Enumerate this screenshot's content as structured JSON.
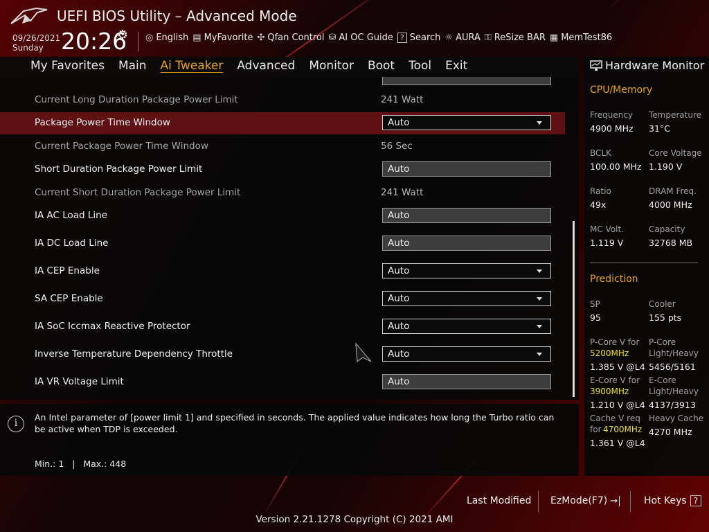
{
  "header": {
    "title": "UEFI BIOS Utility – Advanced Mode",
    "date": "09/26/2021",
    "day": "Sunday",
    "time": "20:26",
    "toolbar": [
      {
        "icon": "globe-icon",
        "label": "English"
      },
      {
        "icon": "favorite-icon",
        "label": "MyFavorite"
      },
      {
        "icon": "fan-icon",
        "label": "Qfan Control"
      },
      {
        "icon": "ai-oc-guide-icon",
        "label": "AI OC Guide"
      },
      {
        "icon": "search-help-icon",
        "label": "Search"
      },
      {
        "icon": "aura-icon",
        "label": "AURA"
      },
      {
        "icon": "resize-bar-icon",
        "label": "ReSize BAR"
      },
      {
        "icon": "memtest-icon",
        "label": "MemTest86"
      }
    ]
  },
  "tabs": [
    {
      "label": "My Favorites",
      "active": false
    },
    {
      "label": "Main",
      "active": false
    },
    {
      "label": "Ai Tweaker",
      "active": true
    },
    {
      "label": "Advanced",
      "active": false
    },
    {
      "label": "Monitor",
      "active": false
    },
    {
      "label": "Boot",
      "active": false
    },
    {
      "label": "Tool",
      "active": false
    },
    {
      "label": "Exit",
      "active": false
    }
  ],
  "settings": [
    {
      "label": "Current Long Duration Package Power Limit",
      "value": "241 Watt",
      "kind": "info"
    },
    {
      "label": "Package Power Time Window",
      "value": "Auto",
      "kind": "dropdown",
      "selected": true
    },
    {
      "label": "Current Package Power Time Window",
      "value": "56 Sec",
      "kind": "info"
    },
    {
      "label": "Short Duration Package Power Limit",
      "value": "Auto",
      "kind": "input"
    },
    {
      "label": "Current Short Duration Package Power Limit",
      "value": "241 Watt",
      "kind": "info"
    },
    {
      "label": "IA AC Load Line",
      "value": "Auto",
      "kind": "input"
    },
    {
      "label": "IA DC Load Line",
      "value": "Auto",
      "kind": "input"
    },
    {
      "label": "IA CEP Enable",
      "value": "Auto",
      "kind": "dropdown"
    },
    {
      "label": "SA CEP Enable",
      "value": "Auto",
      "kind": "dropdown"
    },
    {
      "label": "IA SoC Iccmax Reactive Protector",
      "value": "Auto",
      "kind": "dropdown"
    },
    {
      "label": "Inverse Temperature Dependency Throttle",
      "value": "Auto",
      "kind": "dropdown"
    },
    {
      "label": "IA VR Voltage Limit",
      "value": "Auto",
      "kind": "input"
    }
  ],
  "help": {
    "text": "An Intel parameter of [power limit 1] and specified in seconds. The applied value indicates how long the Turbo ratio can be active when TDP is exceeded.",
    "minmax": "Min.: 1   |   Max.: 448"
  },
  "hw_monitor": {
    "title": "Hardware Monitor",
    "cpu_section": "CPU/Memory",
    "cpu": [
      {
        "label": "Frequency",
        "value": "4900 MHz"
      },
      {
        "label": "Temperature",
        "value": "31°C"
      },
      {
        "label": "BCLK",
        "value": "100.00 MHz"
      },
      {
        "label": "Core Voltage",
        "value": "1.190 V"
      },
      {
        "label": "Ratio",
        "value": "49x"
      },
      {
        "label": "DRAM Freq.",
        "value": "4000 MHz"
      },
      {
        "label": "MC Volt.",
        "value": "1.119 V"
      },
      {
        "label": "Capacity",
        "value": "32768 MB"
      }
    ],
    "prediction_section": "Prediction",
    "sp_label": "SP",
    "sp_value": "95",
    "cooler_label": "Cooler",
    "cooler_value": "155 pts",
    "pcore_v_label": "P-Core V for",
    "pcore_v_freq": "5200MHz",
    "pcore_v_value": "1.385 V @L4",
    "pcore_lh_label1": "P-Core",
    "pcore_lh_label2": "Light/Heavy",
    "pcore_lh_value": "5456/5161",
    "ecore_v_label": "E-Core V for",
    "ecore_v_freq": "3900MHz",
    "ecore_v_value": "1.210 V @L4",
    "ecore_lh_label1": "E-Core",
    "ecore_lh_label2": "Light/Heavy",
    "ecore_lh_value": "4137/3913",
    "cache_v_label": "Cache V req",
    "cache_v_for": "for",
    "cache_v_freq": "4700MHz",
    "cache_v_value": "1.361 V @L4",
    "heavy_cache_label": "Heavy Cache",
    "heavy_cache_value": "4270 MHz"
  },
  "footer": {
    "last_modified": "Last Modified",
    "ezmode": "EzMode(F7)",
    "hotkeys": "Hot Keys",
    "version": "Version 2.21.1278 Copyright (C) 2021 AMI"
  },
  "colors": {
    "accent": "#e8a317",
    "selected_row": "#5e1013",
    "highlight": "#e8e030"
  }
}
